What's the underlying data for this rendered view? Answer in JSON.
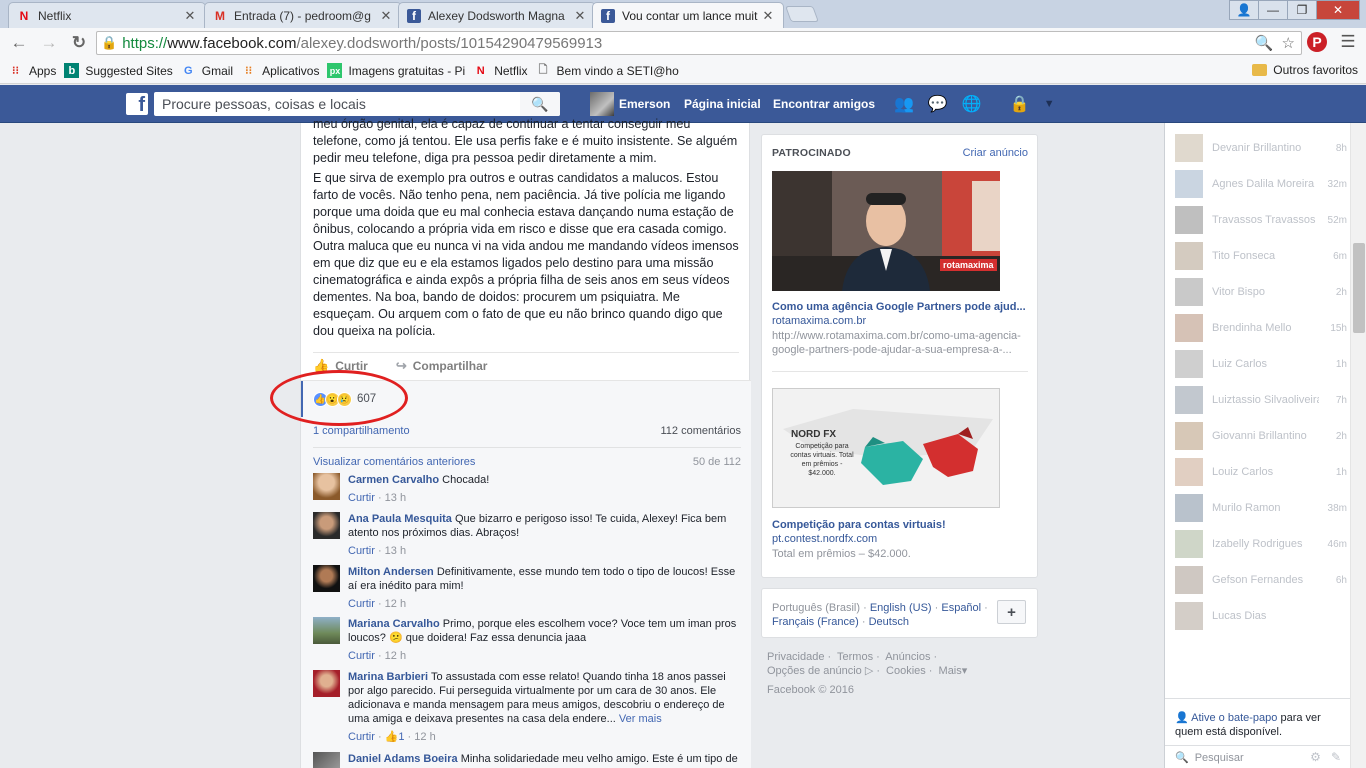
{
  "browser": {
    "tabs": [
      {
        "title": "Netflix",
        "icon": "netflix-icon"
      },
      {
        "title": "Entrada (7) - pedroom@g",
        "icon": "gmail-icon"
      },
      {
        "title": "Alexey Dodsworth Magna",
        "icon": "facebook-icon"
      },
      {
        "title": "Vou contar um lance muit",
        "icon": "facebook-icon"
      }
    ],
    "url": {
      "scheme": "https://",
      "host": "www.facebook.com",
      "path": "/alexey.dodsworth/posts/10154290479569913"
    },
    "bookmarks": [
      "Apps",
      "Suggested Sites",
      "Gmail",
      "Aplicativos",
      "Imagens gratuitas - Pi",
      "Netflix",
      "Bem vindo a SETI@ho"
    ],
    "bookmarks_right": "Outros favoritos",
    "colors": {
      "chrome": "#c8d3e3",
      "secure": "#138a3e"
    }
  },
  "fbbar": {
    "search_placeholder": "Procure pessoas, coisas e locais",
    "user": "Emerson",
    "home": "Página inicial",
    "find_friends": "Encontrar amigos",
    "color": "#3b5998"
  },
  "post": {
    "para1": "meu órgão genital, ela é capaz de continuar a tentar conseguir meu telefone, como já tentou. Ele usa perfis fake e é muito insistente. Se alguém pedir meu telefone, diga pra pessoa pedir diretamente a mim.",
    "para2": "E que sirva de exemplo pra outros e outras candidatos a malucos. Estou farto de vocês. Não tenho pena, nem paciência. Já tive polícia me ligando porque uma doida que eu mal conhecia estava dançando numa estação de ônibus, colocando a própria vida em risco e disse que era casada comigo. Outra maluca que eu nunca vi na vida andou me mandando vídeos imensos em que diz que eu e ela estamos ligados pelo destino para uma missão cinematográfica e ainda expôs a própria filha de seis anos em seus vídeos dementes. Na boa, bando de doidos: procurem um psiquiatra. Me esqueçam. Ou arquem com o fato de que eu não brinco quando digo que dou queixa na polícia.",
    "like_label": "Curtir",
    "share_label": "Compartilhar",
    "reactions_count": "607",
    "shares": "1 compartilhamento",
    "comments_total": "112 comentários",
    "view_previous": "Visualizar comentários anteriores",
    "comments_range": "50 de 112"
  },
  "comments": [
    {
      "author": "Carmen Carvalho",
      "text": "Chocada!",
      "like": "Curtir",
      "time": "13 h"
    },
    {
      "author": "Ana Paula Mesquita",
      "text": "Que bizarro e perigoso isso! Te cuida, Alexey! Fica bem atento nos próximos dias. Abraços!",
      "like": "Curtir",
      "time": "13 h"
    },
    {
      "author": "Milton Andersen",
      "text": "Definitivamente, esse mundo tem todo o tipo de loucos! Esse aí era inédito para mim!",
      "like": "Curtir",
      "time": "12 h"
    },
    {
      "author": "Mariana Carvalho",
      "text": "Primo, porque eles escolhem voce? Voce tem um iman pros loucos?",
      "text2": "que doidera! Faz essa denuncia jaaa",
      "like": "Curtir",
      "time": "12 h"
    },
    {
      "author": "Marina Barbieri",
      "text": "To assustada com esse relato! Quando tinha 18 anos passei por algo parecido. Fui perseguida virtualmente por um cara de 30 anos. Ele adicionava e manda mensagem para meus amigos, descobriu o endereço de uma amiga e deixava presentes na casa dela endere...",
      "more": "Ver mais",
      "like": "Curtir",
      "likes": "1",
      "time": "12 h"
    },
    {
      "author": "Daniel Adams Boeira",
      "text": "Minha solidariedade meu velho amigo. Este é um tipo de"
    }
  ],
  "ads": {
    "header": "PATROCINADO",
    "create": "Criar anúncio",
    "items": [
      {
        "title": "Como uma agência Google Partners pode ajud...",
        "source": "rotamaxima.com.br",
        "desc": "http://www.rotamaxima.com.br/como-uma-agencia-google-partners-pode-ajudar-a-sua-empresa-a-...",
        "image_label": "rotamaxima"
      },
      {
        "title": "Competição para contas virtuais!",
        "source": "pt.contest.nordfx.com",
        "desc": "Total em prêmios – $42.000.",
        "image_brand": "NORD FX",
        "image_text": "Competição para contas virtuais. Total em prêmios - $42.000."
      }
    ]
  },
  "languages": {
    "current": "Português (Brasil)",
    "links": [
      "English (US)",
      "Español",
      "Français (France)",
      "Deutsch"
    ]
  },
  "footer": {
    "links": [
      "Privacidade",
      "Termos",
      "Anúncios",
      "Opções de anúncio",
      "Cookies",
      "Mais"
    ],
    "copyright": "Facebook © 2016"
  },
  "chat": {
    "friends": [
      {
        "name": "Devanir Brillantino",
        "time": "8h"
      },
      {
        "name": "Agnes Dalila Moreira",
        "time": "32m"
      },
      {
        "name": "Travassos Travassos",
        "time": "52m"
      },
      {
        "name": "Tito Fonseca",
        "time": "6m"
      },
      {
        "name": "Vitor Bispo",
        "time": "2h"
      },
      {
        "name": "Brendinha Mello",
        "time": "15h"
      },
      {
        "name": "Luiz Carlos",
        "time": "1h"
      },
      {
        "name": "Luiztassio Silvaoliveira",
        "time": "7h"
      },
      {
        "name": "Giovanni Brillantino",
        "time": "2h"
      },
      {
        "name": "Louiz Carlos",
        "time": "1h"
      },
      {
        "name": "Murilo Ramon",
        "time": "38m"
      },
      {
        "name": "Izabelly Rodrigues",
        "time": "46m"
      },
      {
        "name": "Gefson Fernandes",
        "time": "6h"
      },
      {
        "name": "Lucas Dias",
        "time": ""
      }
    ],
    "activate_link": "Ative o bate-papo",
    "activate_rest": "para ver quem está disponível.",
    "search_placeholder": "Pesquisar"
  }
}
